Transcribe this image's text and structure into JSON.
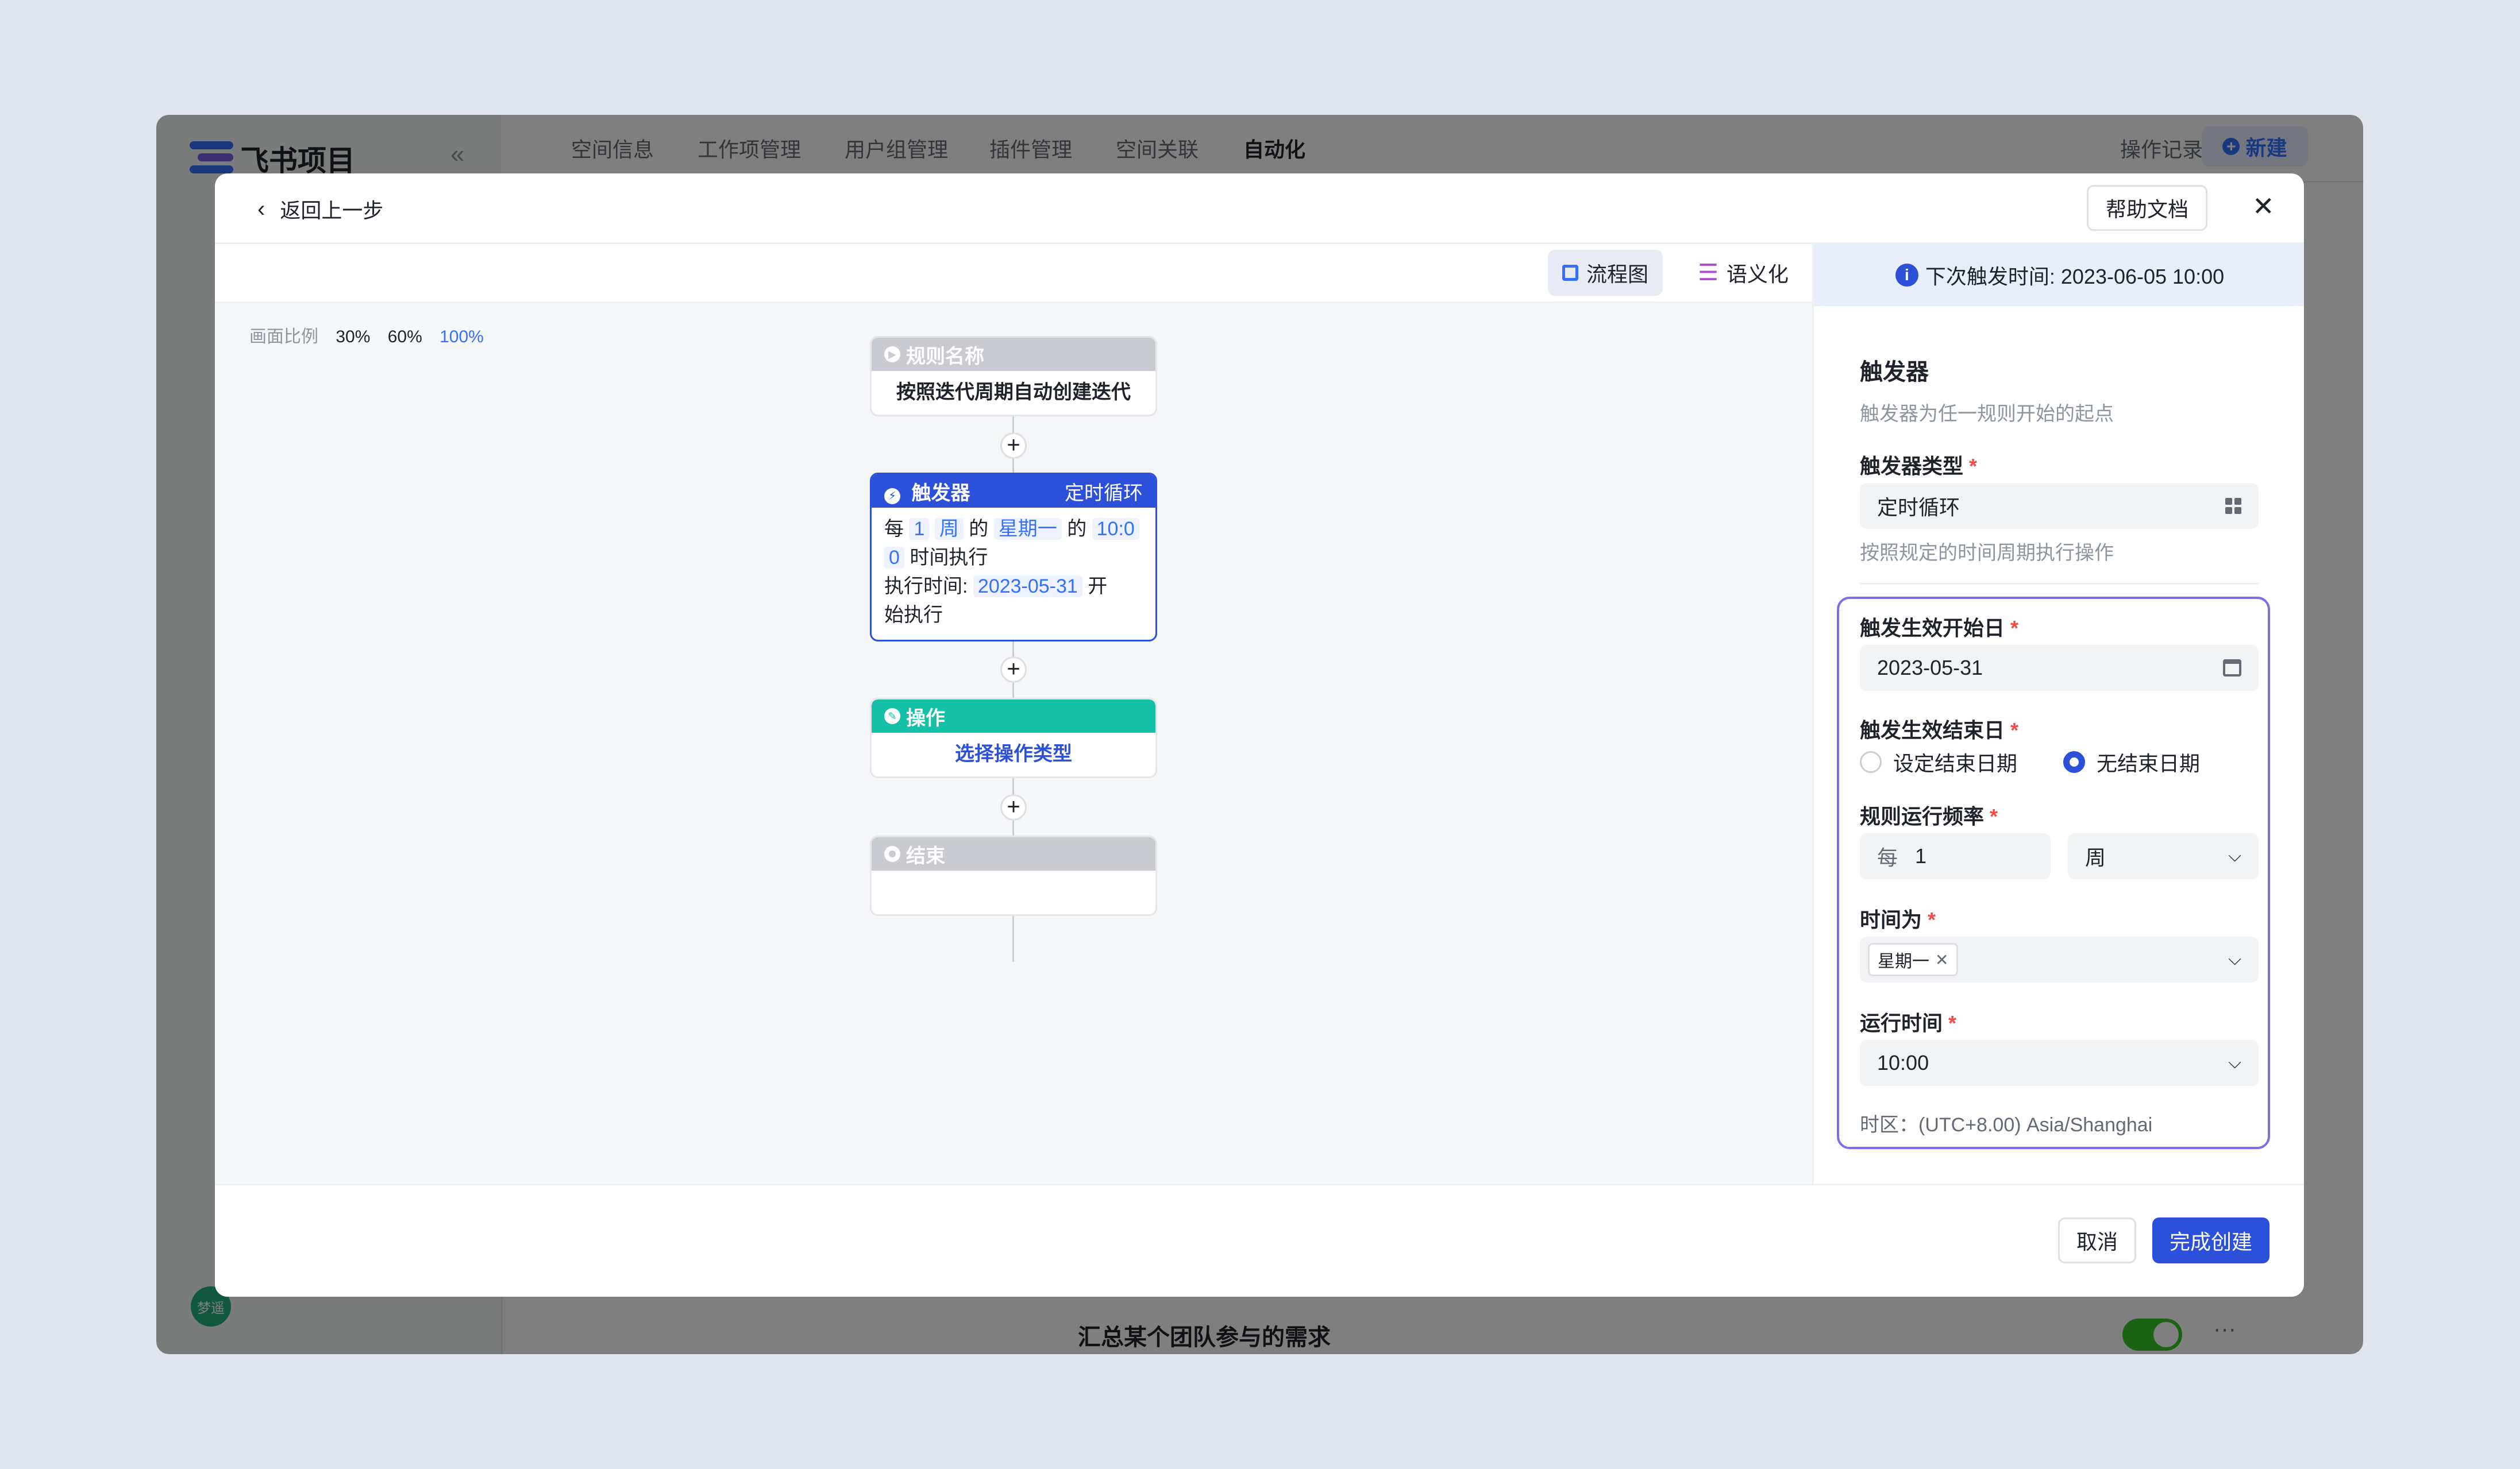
{
  "app": {
    "logo_text": "飞书项目",
    "collapse_icon": "«",
    "nav_tabs": [
      "空间信息",
      "工作项管理",
      "用户组管理",
      "插件管理",
      "空间关联",
      "自动化"
    ],
    "active_tab": "自动化",
    "history_label": "操作记录",
    "new_label": "新建",
    "avatar_text": "梦遥",
    "bg_row_text": "汇总某个团队参与的需求",
    "toggle_on": true
  },
  "modal": {
    "back_label": "返回上一步",
    "help_label": "帮助文档",
    "close_icon": "✕",
    "view_tabs": {
      "flow": "流程图",
      "semantic": "语义化"
    },
    "scale": {
      "label": "画面比例",
      "options": [
        "30%",
        "60%",
        "100%"
      ],
      "active": "100%"
    },
    "flow": {
      "rule": {
        "title": "规则名称",
        "name": "按照迭代周期自动创建迭代"
      },
      "trigger": {
        "title": "触发器",
        "type": "定时循环",
        "t1": "每",
        "count": "1",
        "unit": "周",
        "t2": "的",
        "weekday": "星期一",
        "t3": "的",
        "time_a": "10:0",
        "time_b": "0",
        "t4": "时间执行",
        "t5": "执行时间:",
        "date": "2023-05-31",
        "t6": "开",
        "t7": "始执行"
      },
      "action": {
        "title": "操作",
        "placeholder": "选择操作类型"
      },
      "end": {
        "title": "结束"
      },
      "plus": "+"
    },
    "panel": {
      "next_trigger": "下次触发时间: 2023-06-05 10:00",
      "section_title": "触发器",
      "section_desc": "触发器为任一规则开始的起点",
      "type_label": "触发器类型",
      "type_value": "定时循环",
      "type_desc": "按照规定的时间周期执行操作",
      "start_label": "触发生效开始日",
      "start_value": "2023-05-31",
      "end_label": "触发生效结束日",
      "end_options": [
        "设定结束日期",
        "无结束日期"
      ],
      "end_selected": "无结束日期",
      "freq_label": "规则运行频率",
      "freq_prefix": "每",
      "freq_count": "1",
      "freq_unit": "周",
      "time_for_label": "时间为",
      "time_for_tag": "星期一",
      "run_time_label": "运行时间",
      "run_time_value": "10:00",
      "timezone": "时区：(UTC+8.00) Asia/Shanghai",
      "required_mark": "*"
    },
    "footer": {
      "cancel_label": "取消",
      "confirm_label": "完成创建"
    }
  },
  "colors": {
    "primary": "#3370ff",
    "trigger_head": "#2c50d9",
    "action_head": "#14c0a6",
    "grey_head": "#c9cbd1",
    "focus_border": "#7c6ee8"
  }
}
